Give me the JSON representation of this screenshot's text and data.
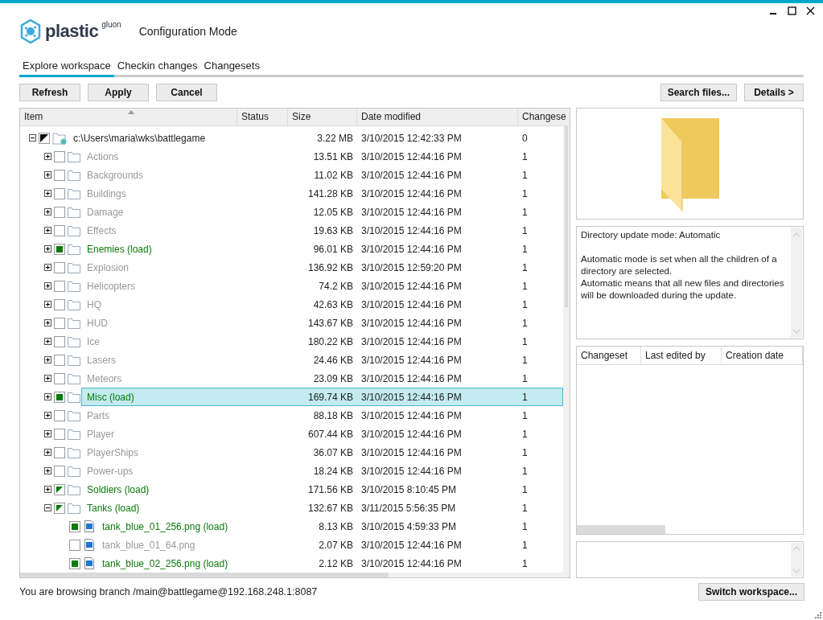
{
  "window": {
    "logo": {
      "name": "plastic",
      "suffix": "gluon"
    },
    "title": "Configuration Mode"
  },
  "tabs": [
    {
      "label": "Explore workspace",
      "selected": true
    },
    {
      "label": "Checkin changes",
      "selected": false
    },
    {
      "label": "Changesets",
      "selected": false
    }
  ],
  "toolbar": {
    "left": [
      "Refresh",
      "Apply",
      "Cancel"
    ],
    "right": [
      "Search files...",
      "Details >"
    ]
  },
  "tree": {
    "columns": [
      "Item",
      "Status",
      "Size",
      "Date modified",
      "Changese"
    ],
    "root": {
      "kind": "root",
      "name": "c:\\Users\\maria\\wks\\battlegame",
      "size": "3.22 MB",
      "date": "3/10/2015 12:42:33 PM",
      "changeset": "0",
      "checked": true,
      "mixed": true,
      "expanded": true,
      "selected": false,
      "children": [
        {
          "kind": "folder",
          "name": "Actions",
          "size": "13.51 KB",
          "date": "3/10/2015 12:44:16 PM",
          "changeset": "1",
          "checked": false,
          "mixed": false,
          "expanded": false,
          "selected": false
        },
        {
          "kind": "folder",
          "name": "Backgrounds",
          "size": "11.02 KB",
          "date": "3/10/2015 12:44:16 PM",
          "changeset": "1",
          "checked": false,
          "mixed": false,
          "expanded": false,
          "selected": false
        },
        {
          "kind": "folder",
          "name": "Buildings",
          "size": "141.28 KB",
          "date": "3/10/2015 12:44:16 PM",
          "changeset": "1",
          "checked": false,
          "mixed": false,
          "expanded": false,
          "selected": false
        },
        {
          "kind": "folder",
          "name": "Damage",
          "size": "12.05 KB",
          "date": "3/10/2015 12:44:16 PM",
          "changeset": "1",
          "checked": false,
          "mixed": false,
          "expanded": false,
          "selected": false
        },
        {
          "kind": "folder",
          "name": "Effects",
          "size": "19.63 KB",
          "date": "3/10/2015 12:44:16 PM",
          "changeset": "1",
          "checked": false,
          "mixed": false,
          "expanded": false,
          "selected": false
        },
        {
          "kind": "folder",
          "name": "Enemies (load)",
          "size": "96.01 KB",
          "date": "3/10/2015 12:44:16 PM",
          "changeset": "1",
          "checked": true,
          "mixed": false,
          "expanded": false,
          "selected": false
        },
        {
          "kind": "folder",
          "name": "Explosion",
          "size": "136.92 KB",
          "date": "3/10/2015 12:59:20 PM",
          "changeset": "1",
          "checked": false,
          "mixed": false,
          "expanded": false,
          "selected": false
        },
        {
          "kind": "folder",
          "name": "Helicopters",
          "size": "74.2 KB",
          "date": "3/10/2015 12:44:16 PM",
          "changeset": "1",
          "checked": false,
          "mixed": false,
          "expanded": false,
          "selected": false
        },
        {
          "kind": "folder",
          "name": "HQ",
          "size": "42.63 KB",
          "date": "3/10/2015 12:44:16 PM",
          "changeset": "1",
          "checked": false,
          "mixed": false,
          "expanded": false,
          "selected": false
        },
        {
          "kind": "folder",
          "name": "HUD",
          "size": "143.67 KB",
          "date": "3/10/2015 12:44:16 PM",
          "changeset": "1",
          "checked": false,
          "mixed": false,
          "expanded": false,
          "selected": false
        },
        {
          "kind": "folder",
          "name": "Ice",
          "size": "180.22 KB",
          "date": "3/10/2015 12:44:16 PM",
          "changeset": "1",
          "checked": false,
          "mixed": false,
          "expanded": false,
          "selected": false
        },
        {
          "kind": "folder",
          "name": "Lasers",
          "size": "24.46 KB",
          "date": "3/10/2015 12:44:16 PM",
          "changeset": "1",
          "checked": false,
          "mixed": false,
          "expanded": false,
          "selected": false
        },
        {
          "kind": "folder",
          "name": "Meteors",
          "size": "23.09 KB",
          "date": "3/10/2015 12:44:16 PM",
          "changeset": "1",
          "checked": false,
          "mixed": false,
          "expanded": false,
          "selected": false
        },
        {
          "kind": "folder",
          "name": "Misc (load)",
          "size": "169.74 KB",
          "date": "3/10/2015 12:44:16 PM",
          "changeset": "1",
          "checked": true,
          "mixed": false,
          "expanded": false,
          "selected": true
        },
        {
          "kind": "folder",
          "name": "Parts",
          "size": "88.18 KB",
          "date": "3/10/2015 12:44:16 PM",
          "changeset": "1",
          "checked": false,
          "mixed": false,
          "expanded": false,
          "selected": false
        },
        {
          "kind": "folder",
          "name": "Player",
          "size": "607.44 KB",
          "date": "3/10/2015 12:44:16 PM",
          "changeset": "1",
          "checked": false,
          "mixed": false,
          "expanded": false,
          "selected": false
        },
        {
          "kind": "folder",
          "name": "PlayerShips",
          "size": "36.07 KB",
          "date": "3/10/2015 12:44:16 PM",
          "changeset": "1",
          "checked": false,
          "mixed": false,
          "expanded": false,
          "selected": false
        },
        {
          "kind": "folder",
          "name": "Power-ups",
          "size": "18.24 KB",
          "date": "3/10/2015 12:44:16 PM",
          "changeset": "1",
          "checked": false,
          "mixed": false,
          "expanded": false,
          "selected": false
        },
        {
          "kind": "folder",
          "name": "Soldiers (load)",
          "size": "171.56 KB",
          "date": "3/10/2015 8:10:45 PM",
          "changeset": "1",
          "checked": true,
          "mixed": true,
          "expanded": false,
          "selected": false
        },
        {
          "kind": "folder",
          "name": "Tanks (load)",
          "size": "132.67 KB",
          "date": "3/11/2015 5:56:35 PM",
          "changeset": "1",
          "checked": true,
          "mixed": true,
          "expanded": true,
          "selected": false,
          "children": [
            {
              "kind": "file",
              "name": "tank_blue_01_256.png (load)",
              "size": "8.13 KB",
              "date": "3/10/2015 4:59:33 PM",
              "changeset": "1",
              "checked": true,
              "mixed": false,
              "selected": false
            },
            {
              "kind": "file",
              "name": "tank_blue_01_64.png",
              "size": "2.07 KB",
              "date": "3/10/2015 12:44:16 PM",
              "changeset": "1",
              "checked": false,
              "mixed": false,
              "selected": false
            },
            {
              "kind": "file",
              "name": "tank_blue_02_256.png (load)",
              "size": "2.12 KB",
              "date": "3/10/2015 12:44:16 PM",
              "changeset": "1",
              "checked": true,
              "mixed": false,
              "selected": false
            }
          ]
        }
      ]
    }
  },
  "info": {
    "paragraphs": [
      "Directory update mode: Automatic",
      "Automatic mode is set when all the children of a directory are selected.\nAutomatic means that all new files and directories will be downloaded during the update."
    ]
  },
  "details_table": {
    "columns": [
      "Changeset",
      "Last edited by",
      "Creation date"
    ]
  },
  "status_bar": {
    "text": "You are browsing branch /main@battlegame@192.168.248.1:8087",
    "button": "Switch workspace..."
  }
}
